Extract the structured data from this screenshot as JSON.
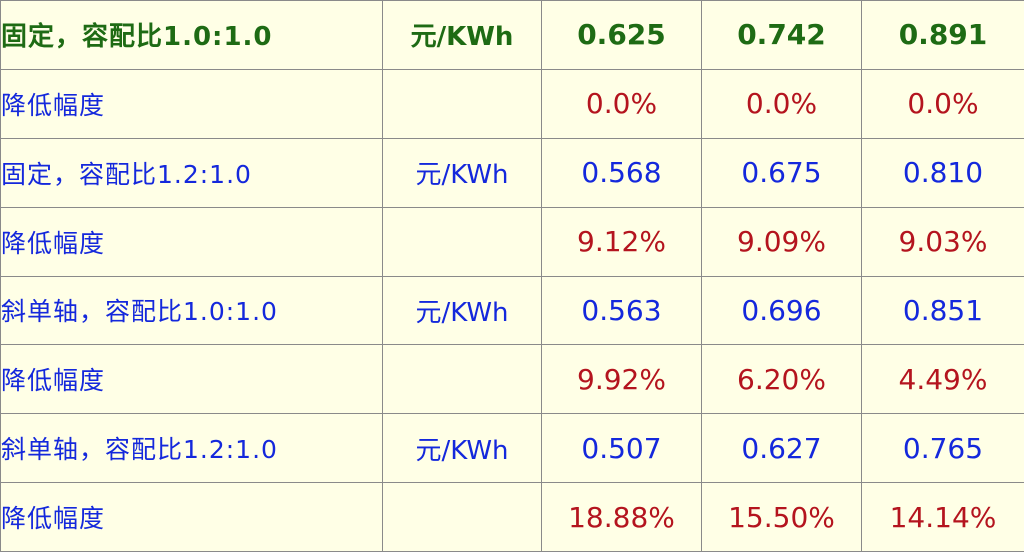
{
  "rows": [
    {
      "label": "固定，容配比1.0:1.0",
      "unit": "元/KWh",
      "values": [
        "0.625",
        "0.742",
        "0.891"
      ]
    },
    {
      "label": "降低幅度",
      "unit": "",
      "values": [
        "0.0%",
        "0.0%",
        "0.0%"
      ]
    },
    {
      "label": "固定，容配比1.2:1.0",
      "unit": "元/KWh",
      "values": [
        "0.568",
        "0.675",
        "0.810"
      ]
    },
    {
      "label": "降低幅度",
      "unit": "",
      "values": [
        "9.12%",
        "9.09%",
        "9.03%"
      ]
    },
    {
      "label": "斜单轴，容配比1.0:1.0",
      "unit": "元/KWh",
      "values": [
        "0.563",
        "0.696",
        "0.851"
      ]
    },
    {
      "label": "降低幅度",
      "unit": "",
      "values": [
        "9.92%",
        "6.20%",
        "4.49%"
      ]
    },
    {
      "label": "斜单轴，容配比1.2:1.0",
      "unit": "元/KWh",
      "values": [
        "0.507",
        "0.627",
        "0.765"
      ]
    },
    {
      "label": "降低幅度",
      "unit": "",
      "values": [
        "18.88%",
        "15.50%",
        "14.14%"
      ]
    }
  ],
  "colors": {
    "background": "#FFFFE6",
    "header_text": "#1E6B14",
    "cost_text": "#1428DC",
    "reduction_text": "#B4141E",
    "border": "#8A8A8A"
  }
}
